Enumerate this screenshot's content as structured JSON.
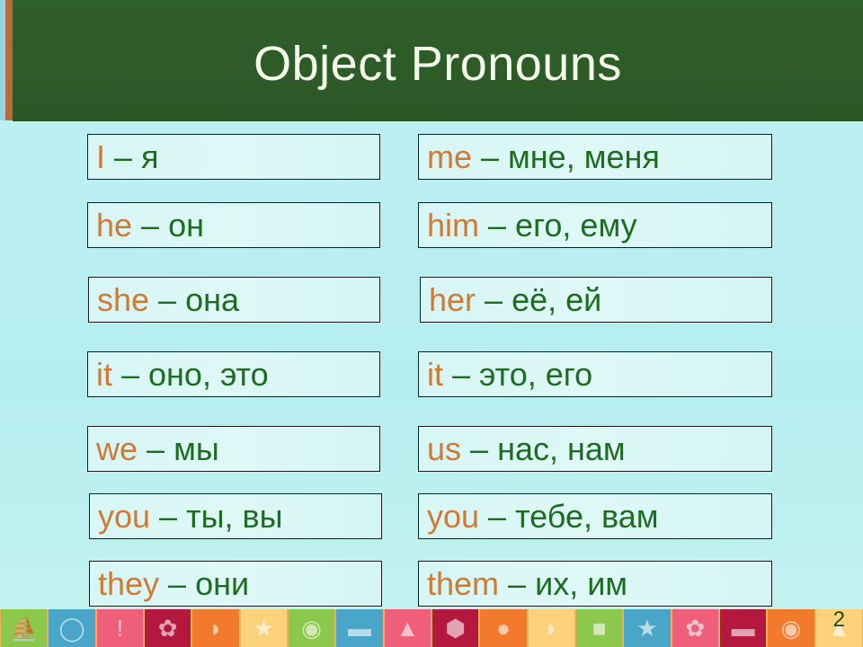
{
  "slide": {
    "title": "Object Pronouns",
    "page_number": "2",
    "colors": {
      "header_bg": "#2e5b28",
      "body_bg": "#bff0f2",
      "english_word": "#d07a33",
      "russian_word": "#1e6c22",
      "title_text": "#f2fbea"
    }
  },
  "subject_pronouns": [
    {
      "en": "I",
      "dash": " – ",
      "ru": "я"
    },
    {
      "en": "he",
      "dash": " – ",
      "ru": "он"
    },
    {
      "en": "she",
      "dash": " – ",
      "ru": "она"
    },
    {
      "en": "it",
      "dash": " – ",
      "ru": "оно, это"
    },
    {
      "en": "we",
      "dash": " – ",
      "ru": "мы"
    },
    {
      "en": "you",
      "dash": " – ",
      "ru": "ты, вы"
    },
    {
      "en": "they",
      "dash": " – ",
      "ru": "они"
    }
  ],
  "object_pronouns": [
    {
      "en": "me",
      "dash": " – ",
      "ru": "мне, меня"
    },
    {
      "en": "him",
      "dash": " – ",
      "ru": "его, ему"
    },
    {
      "en": "her",
      "dash": " – ",
      "ru": "её, ей"
    },
    {
      "en": "it",
      "dash": " – ",
      "ru": "это, его"
    },
    {
      "en": "us",
      "dash": " – ",
      "ru": "нас, нам"
    },
    {
      "en": "you",
      "dash": " – ",
      "ru": "тебе, вам"
    },
    {
      "en": "them",
      "dash": " – ",
      "ru": "их, им"
    }
  ],
  "footer_tiles": [
    {
      "icon": "sailboat-icon",
      "glyph": "⛵",
      "bg": "#8cc84b"
    },
    {
      "icon": "ring-icon",
      "glyph": "◯",
      "bg": "#4aa6c9"
    },
    {
      "icon": "exclamation-icon",
      "glyph": "!",
      "bg": "#ef5f7a"
    },
    {
      "icon": "flower-icon",
      "glyph": "✿",
      "bg": "#b5183f"
    },
    {
      "icon": "fish-icon",
      "glyph": "◗",
      "bg": "#f27a2c"
    },
    {
      "icon": "star-icon",
      "glyph": "★",
      "bg": "#fdd27c"
    },
    {
      "icon": "cat-icon",
      "glyph": "◉",
      "bg": "#8cc84b"
    },
    {
      "icon": "car-icon",
      "glyph": "▬",
      "bg": "#4aa6c9"
    },
    {
      "icon": "sailboat-icon",
      "glyph": "▲",
      "bg": "#ef5f7a"
    },
    {
      "icon": "hexagon-icon",
      "glyph": "⬢",
      "bg": "#b5183f"
    },
    {
      "icon": "balloon-icon",
      "glyph": "●",
      "bg": "#f27a2c"
    },
    {
      "icon": "fish-icon",
      "glyph": "◗",
      "bg": "#fdd27c"
    },
    {
      "icon": "square-icon",
      "glyph": "■",
      "bg": "#8cc84b"
    },
    {
      "icon": "star-icon",
      "glyph": "★",
      "bg": "#4aa6c9"
    },
    {
      "icon": "flower-icon",
      "glyph": "✿",
      "bg": "#ef5f7a"
    },
    {
      "icon": "car-icon",
      "glyph": "▬",
      "bg": "#b5183f"
    },
    {
      "icon": "cat-icon",
      "glyph": "◉",
      "bg": "#f27a2c"
    },
    {
      "icon": "triangle-icon",
      "glyph": "▲",
      "bg": "#fdd27c"
    }
  ]
}
